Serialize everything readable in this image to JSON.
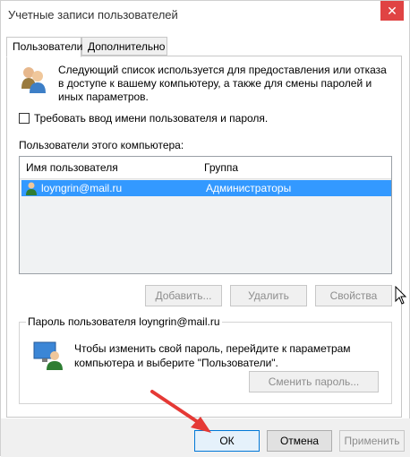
{
  "window": {
    "title": "Учетные записи пользователей",
    "close_glyph": "✕",
    "close_color": "#e04343"
  },
  "tabs": [
    {
      "label": "Пользователи",
      "active": true
    },
    {
      "label": "Дополнительно",
      "active": false
    }
  ],
  "main": {
    "description": "Следующий список используется для предоставления или отказа в доступе к вашему компьютеру, а также для смены паролей и иных параметров.",
    "require_login_checkbox": {
      "label": "Требовать ввод имени пользователя и пароля.",
      "checked": false
    },
    "users_list_label": "Пользователи этого компьютера:",
    "columns": [
      "Имя пользователя",
      "Группа"
    ],
    "rows": [
      {
        "user": "loyngrin@mail.ru",
        "group": "Администраторы",
        "selected": true
      }
    ],
    "buttons": {
      "add": "Добавить...",
      "remove": "Удалить",
      "properties": "Свойства"
    }
  },
  "password_group": {
    "legend": "Пароль пользователя loyngrin@mail.ru",
    "text": "Чтобы изменить свой пароль, перейдите к параметрам компьютера и выберите \"Пользователи\".",
    "change_button": "Сменить пароль..."
  },
  "dialog_buttons": {
    "ok": "ОК",
    "cancel": "Отмена",
    "apply": "Применить"
  },
  "colors": {
    "selection": "#3399ff",
    "focus_border": "#0078d7",
    "annotation_arrow": "#e53935"
  }
}
